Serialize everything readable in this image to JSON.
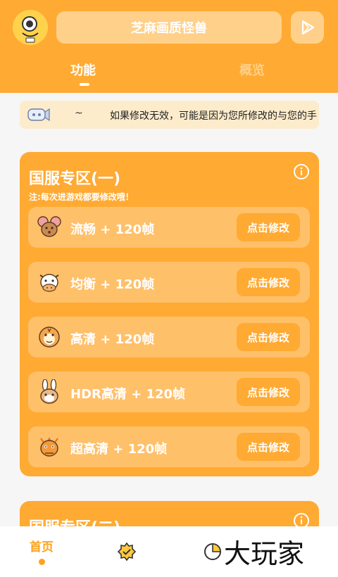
{
  "header": {
    "title": "芝麻画质怪兽",
    "tabs": [
      {
        "label": "功能"
      },
      {
        "label": "概览"
      }
    ]
  },
  "notice": {
    "prefix": "~",
    "text": "如果修改无效，可能是因为您所修改的与您的手"
  },
  "card1": {
    "title": "国服专区(一)",
    "note": "注:每次进游戏都要修改哦！",
    "rows": [
      {
        "label": "流畅 + 120帧",
        "button": "点击修改",
        "icon": "mouse-icon"
      },
      {
        "label": "均衡 + 120帧",
        "button": "点击修改",
        "icon": "cow-icon"
      },
      {
        "label": "高清 + 120帧",
        "button": "点击修改",
        "icon": "tiger-icon"
      },
      {
        "label": "HDR高清 + 120帧",
        "button": "点击修改",
        "icon": "rabbit-icon"
      },
      {
        "label": "超高清 + 120帧",
        "button": "点击修改",
        "icon": "dragon-icon"
      }
    ]
  },
  "card2": {
    "title": "国服专区(二)"
  },
  "bottom_nav": {
    "home_label": "首页",
    "watermark": "大玩家"
  },
  "colors": {
    "primary": "#ffaa33",
    "accent_light": "#ffd089",
    "row_bg": "#ffc06a",
    "notice_bg": "#fdeccb"
  }
}
